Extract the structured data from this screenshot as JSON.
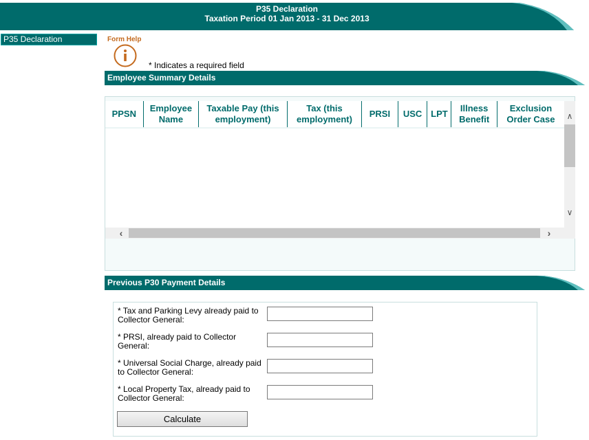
{
  "header": {
    "title": "P35 Declaration",
    "subtitle": "Taxation Period 01 Jan 2013 - 31 Dec 2013"
  },
  "nav": {
    "items": [
      {
        "label": "P35 Declaration"
      }
    ]
  },
  "form_help": {
    "label": "Form Help",
    "icon": "info-icon",
    "required_note": "* Indicates a required field"
  },
  "employee_summary": {
    "title": "Employee Summary Details",
    "columns": [
      "PPSN",
      "Employee Name",
      "Taxable Pay (this employment)",
      "Tax (this employment)",
      "PRSI",
      "USC",
      "LPT",
      "Illness Benefit",
      "Exclusion Order Case"
    ],
    "rows": []
  },
  "p30": {
    "title": "Previous P30 Payment Details",
    "fields": [
      {
        "label": "* Tax and Parking Levy already paid to Collector General:",
        "value": ""
      },
      {
        "label": "* PRSI, already paid to Collector General:",
        "value": ""
      },
      {
        "label": "* Universal Social Charge, already paid to Collector General:",
        "value": ""
      },
      {
        "label": "* Local Property Tax, already paid to Collector General:",
        "value": ""
      }
    ],
    "calculate_label": "Calculate"
  },
  "colors": {
    "brand": "#006b6b",
    "accent_light": "#5fbfbf",
    "help_orange": "#c46a1e"
  }
}
